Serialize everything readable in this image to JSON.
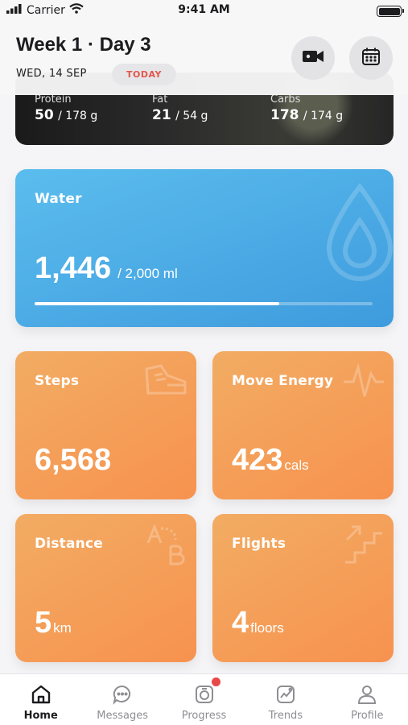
{
  "status": {
    "carrier": "Carrier",
    "time": "9:41 AM"
  },
  "header": {
    "title": "Week 1 · Day 3",
    "date": "WED, 14 SEP",
    "today": "TODAY"
  },
  "nutrition": [
    {
      "label": "Protein",
      "value": "50",
      "total": "/ 178 g"
    },
    {
      "label": "Fat",
      "value": "21",
      "total": "/ 54 g"
    },
    {
      "label": "Carbs",
      "value": "178",
      "total": "/ 174 g"
    }
  ],
  "water": {
    "label": "Water",
    "value": "1,446",
    "total": "/ 2,000 ml",
    "progress": 0.723
  },
  "steps": {
    "label": "Steps",
    "value": "6,568"
  },
  "move_energy": {
    "label": "Move Energy",
    "value": "423",
    "unit": "cals"
  },
  "distance": {
    "label": "Distance",
    "value": "5",
    "unit": "km"
  },
  "flights": {
    "label": "Flights",
    "value": "4",
    "unit": "floors"
  },
  "tabs": [
    {
      "label": "Home",
      "icon": "home-icon",
      "active": true
    },
    {
      "label": "Messages",
      "icon": "chat-icon"
    },
    {
      "label": "Progress",
      "icon": "progress-icon",
      "badge": true
    },
    {
      "label": "Trends",
      "icon": "trends-icon"
    },
    {
      "label": "Profile",
      "icon": "profile-icon"
    }
  ],
  "colors": {
    "water": "#4aa9e5",
    "orange": "#f5a25a",
    "today": "#e2574c",
    "badge": "#e94848"
  }
}
